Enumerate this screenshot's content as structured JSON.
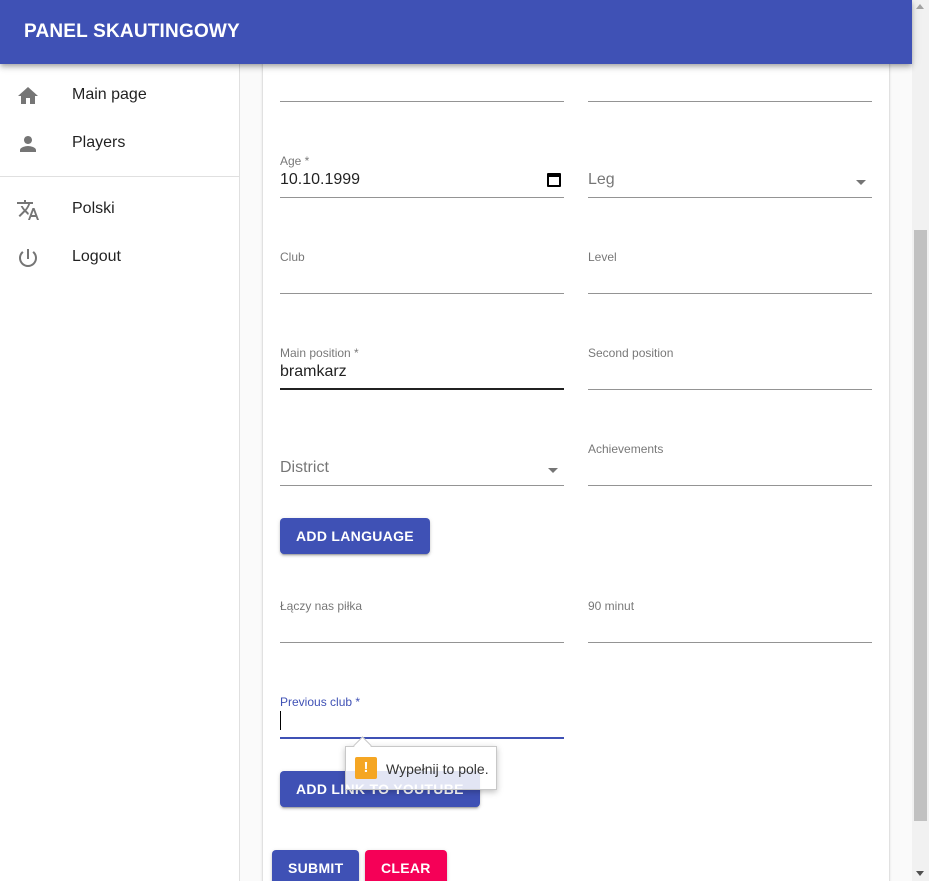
{
  "app": {
    "title": "PANEL SKAUTINGOWY"
  },
  "nav": {
    "items": [
      {
        "label": "Main page",
        "icon": "home-icon"
      },
      {
        "label": "Players",
        "icon": "person-icon"
      },
      {
        "label": "Polski",
        "icon": "translate-icon"
      },
      {
        "label": "Logout",
        "icon": "power-icon"
      }
    ]
  },
  "form": {
    "age": {
      "label": "Age *",
      "value": "10.10.1999"
    },
    "leg": {
      "placeholder": "Leg"
    },
    "club": {
      "label": "Club",
      "value": ""
    },
    "level": {
      "label": "Level",
      "value": ""
    },
    "main_position": {
      "label": "Main position *",
      "value": "bramkarz"
    },
    "second_position": {
      "label": "Second position",
      "value": ""
    },
    "district": {
      "placeholder": "District"
    },
    "achievements": {
      "label": "Achievements",
      "value": ""
    },
    "add_language_label": "ADD LANGUAGE",
    "laczy_nas_pilka": {
      "label": "Łączy nas piłka",
      "value": ""
    },
    "minut90": {
      "label": "90 minut",
      "value": ""
    },
    "previous_club": {
      "label": "Previous club *",
      "value": ""
    },
    "add_youtube_label": "ADD LINK TO YOUTUBE",
    "submit_label": "SUBMIT",
    "clear_label": "CLEAR"
  },
  "validation": {
    "message": "Wypełnij to pole."
  },
  "colors": {
    "primary": "#3f51b5",
    "secondary": "#f50057",
    "warning": "#f5a623"
  }
}
